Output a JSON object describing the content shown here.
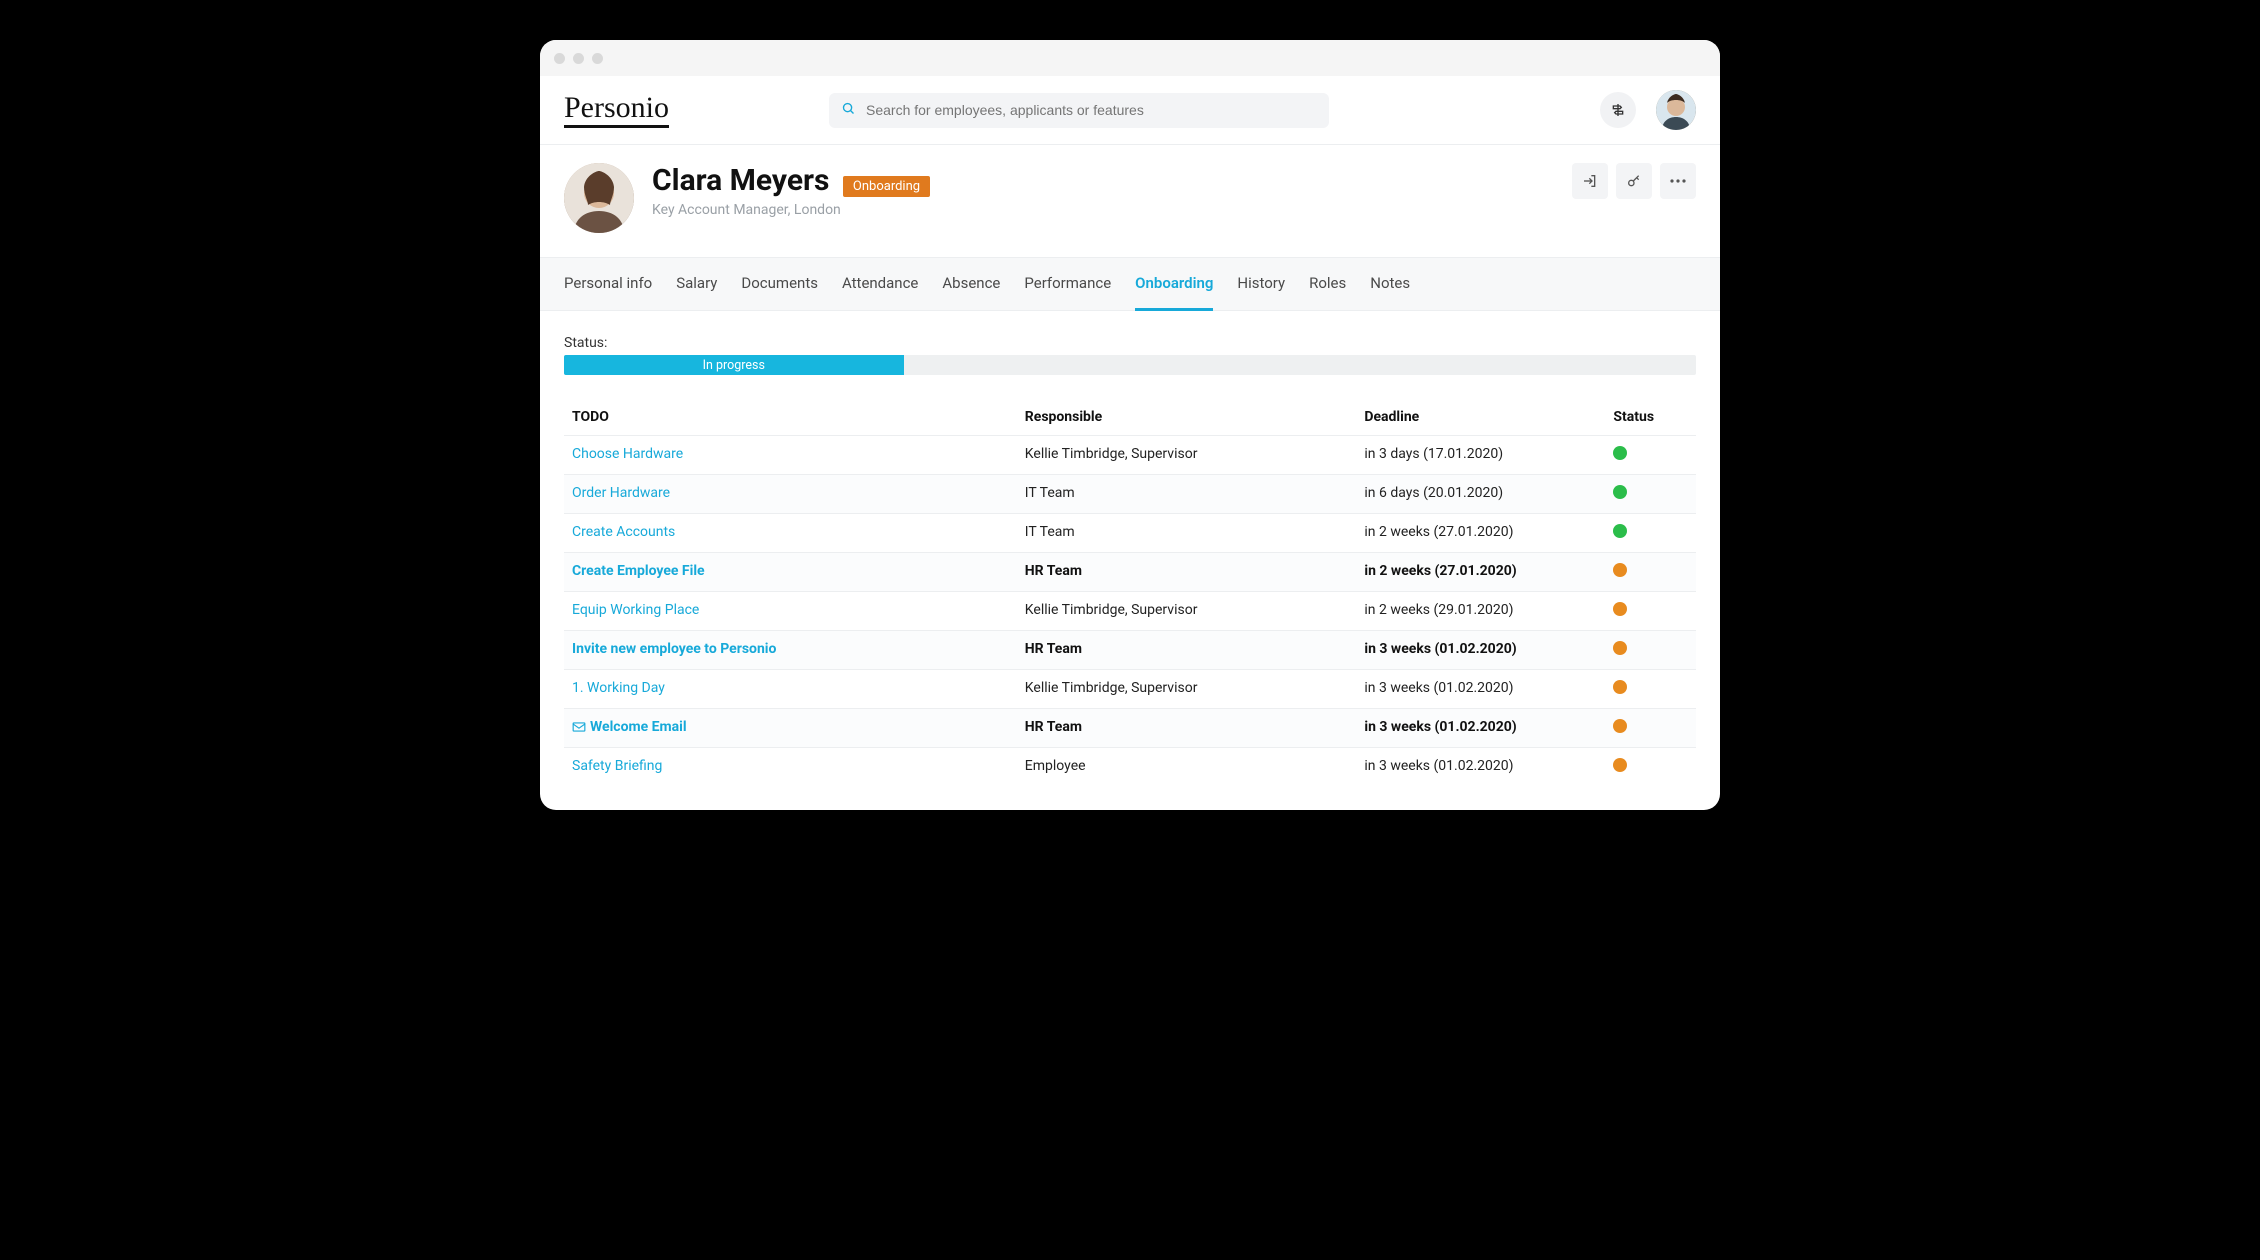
{
  "app": {
    "logo_text": "Personio"
  },
  "search": {
    "placeholder": "Search for employees, applicants or features"
  },
  "profile": {
    "name": "Clara Meyers",
    "badge": "Onboarding",
    "subtitle": "Key Account Manager, London"
  },
  "tabs": [
    {
      "label": "Personal info",
      "active": false
    },
    {
      "label": "Salary",
      "active": false
    },
    {
      "label": "Documents",
      "active": false
    },
    {
      "label": "Attendance",
      "active": false
    },
    {
      "label": "Absence",
      "active": false
    },
    {
      "label": "Performance",
      "active": false
    },
    {
      "label": "Onboarding",
      "active": true
    },
    {
      "label": "History",
      "active": false
    },
    {
      "label": "Roles",
      "active": false
    },
    {
      "label": "Notes",
      "active": false
    }
  ],
  "status": {
    "label": "Status:",
    "text": "In progress",
    "percent": 30
  },
  "table": {
    "columns": [
      "TODO",
      "Responsible",
      "Deadline",
      "Status"
    ],
    "rows": [
      {
        "todo": "Choose Hardware",
        "responsible": "Kellie Timbridge, Supervisor",
        "deadline": "in 3 days (17.01.2020)",
        "status": "green",
        "bold": false,
        "mail_icon": false
      },
      {
        "todo": "Order Hardware",
        "responsible": "IT Team",
        "deadline": "in 6 days (20.01.2020)",
        "status": "green",
        "bold": false,
        "mail_icon": false
      },
      {
        "todo": "Create Accounts",
        "responsible": "IT Team",
        "deadline": "in 2 weeks (27.01.2020)",
        "status": "green",
        "bold": false,
        "mail_icon": false
      },
      {
        "todo": "Create Employee File",
        "responsible": "HR Team",
        "deadline": "in 2 weeks (27.01.2020)",
        "status": "orange",
        "bold": true,
        "mail_icon": false
      },
      {
        "todo": "Equip Working Place",
        "responsible": "Kellie Timbridge, Supervisor",
        "deadline": "in 2 weeks (29.01.2020)",
        "status": "orange",
        "bold": false,
        "mail_icon": false
      },
      {
        "todo": "Invite new employee to Personio",
        "responsible": "HR Team",
        "deadline": "in 3 weeks (01.02.2020)",
        "status": "orange",
        "bold": true,
        "mail_icon": false
      },
      {
        "todo": "1. Working Day",
        "responsible": "Kellie Timbridge, Supervisor",
        "deadline": "in 3 weeks (01.02.2020)",
        "status": "orange",
        "bold": false,
        "mail_icon": false
      },
      {
        "todo": "Welcome Email",
        "responsible": "HR Team",
        "deadline": "in 3 weeks (01.02.2020)",
        "status": "orange",
        "bold": true,
        "mail_icon": true
      },
      {
        "todo": "Safety Briefing",
        "responsible": "Employee",
        "deadline": "in 3 weeks (01.02.2020)",
        "status": "orange",
        "bold": false,
        "mail_icon": false
      }
    ]
  }
}
